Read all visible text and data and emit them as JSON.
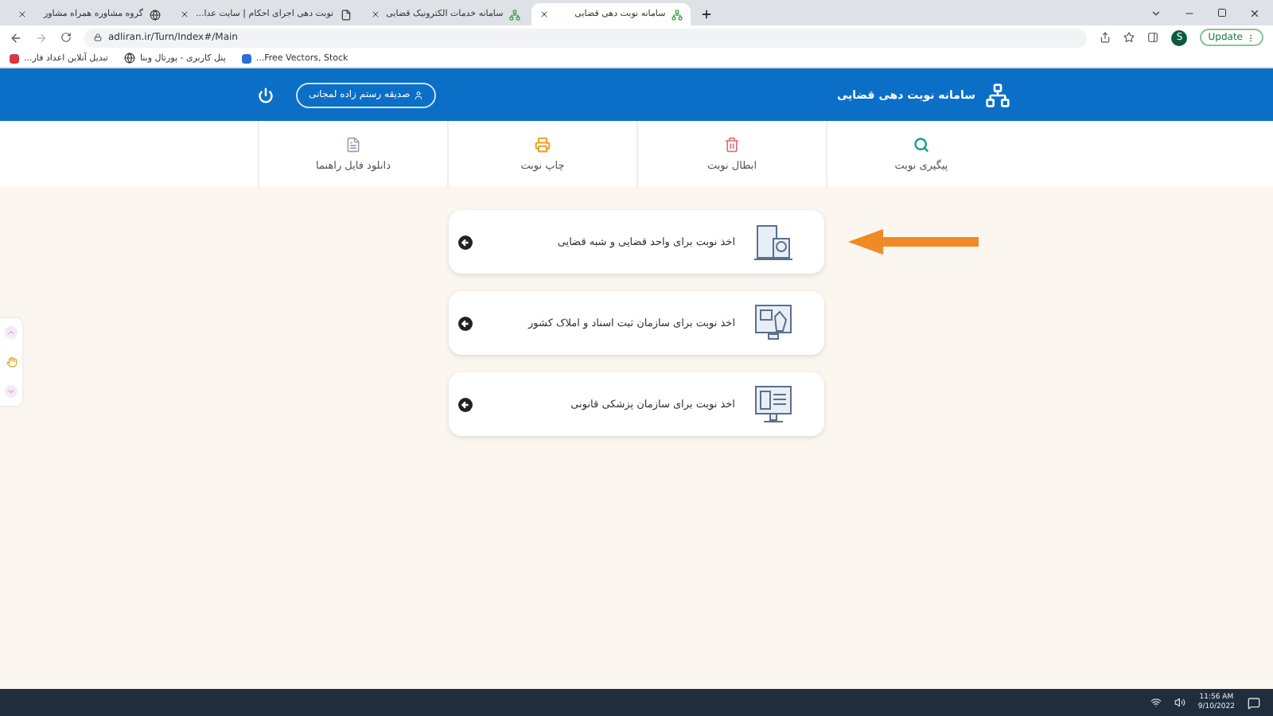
{
  "browser": {
    "tabs": [
      {
        "title": "سامانه نوبت دهی قضایی",
        "selected": true,
        "kind": "tree"
      },
      {
        "title": "سامانه خدمات الکترونیک قضایی",
        "selected": false,
        "kind": "tree"
      },
      {
        "title": "نوبت دهی اجرای احکام | سایت عدا...",
        "selected": false,
        "kind": "doc"
      },
      {
        "title": "گروه مشاوره همراه مشاور",
        "selected": false,
        "kind": "globe"
      }
    ],
    "address": "adliran.ir/Turn/Index#/Main",
    "profile_initial": "S",
    "update_label": "Update",
    "bookmarks": [
      {
        "title": "Free Vectors, Stock...",
        "kind": "blue"
      },
      {
        "title": "پنل کاربری - پورتال وبنا",
        "kind": "globe"
      },
      {
        "title": "تبدیل آنلاین اعداد فار...",
        "kind": "red"
      }
    ]
  },
  "header": {
    "title": "سامانه نوبت دهی قضایی",
    "user": "صدیقه رستم زاده لمجانی"
  },
  "nav": [
    {
      "label": "پیگیری نوبت",
      "kind": "search"
    },
    {
      "label": "ابطال نوبت",
      "kind": "trash"
    },
    {
      "label": "چاپ نوبت",
      "kind": "print"
    },
    {
      "label": "دانلود فایل راهنما",
      "kind": "file"
    }
  ],
  "cards": [
    {
      "label": "اخذ نوبت برای واحد قضایی و شبه قضایی",
      "kind": "building"
    },
    {
      "label": "اخذ نوبت برای سازمان ثبت اسناد و املاک کشور",
      "kind": "touch"
    },
    {
      "label": "اخذ نوبت برای سازمان پزشکی قانونی",
      "kind": "form"
    }
  ],
  "taskbar": {
    "time": "11:56 AM",
    "date": "9/10/2022"
  }
}
